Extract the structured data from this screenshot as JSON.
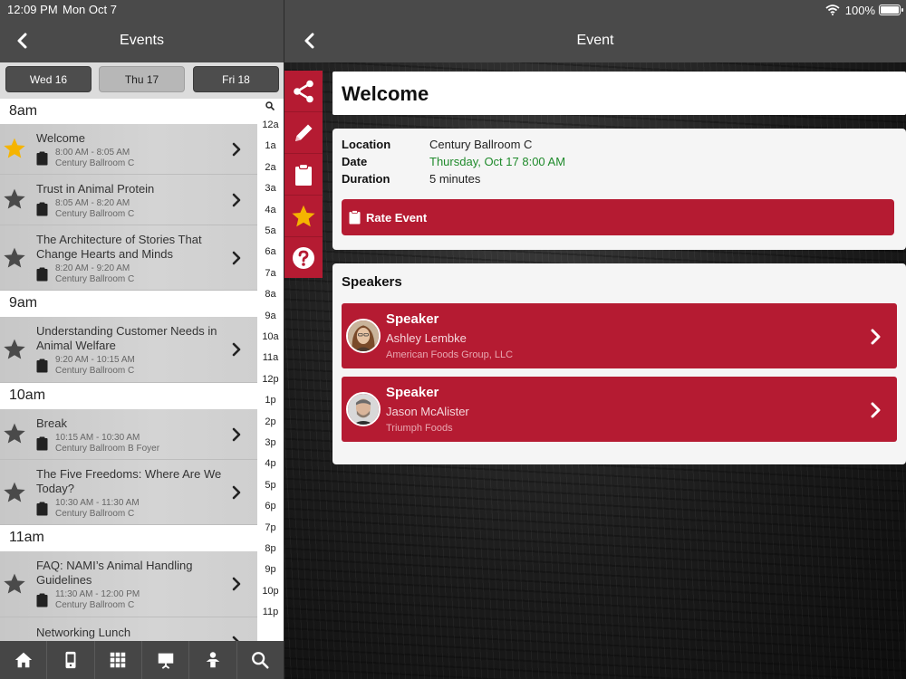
{
  "status": {
    "time": "12:09 PM",
    "date": "Mon Oct 7",
    "battery": "100%"
  },
  "left_nav": {
    "title": "Events"
  },
  "right_nav": {
    "title": "Event"
  },
  "day_tabs": [
    {
      "label": "Wed 16",
      "active": false
    },
    {
      "label": "Thu 17",
      "active": true
    },
    {
      "label": "Fri 18",
      "active": false
    }
  ],
  "hours": [
    "8am",
    "9am",
    "10am",
    "11am"
  ],
  "events": [
    {
      "title": "Welcome",
      "time": "8:00 AM - 8:05 AM",
      "location": "Century Ballroom C",
      "favorited": true
    },
    {
      "title": "Trust in Animal Protein",
      "time": "8:05 AM - 8:20 AM",
      "location": "Century Ballroom C",
      "favorited": false
    },
    {
      "title": "The Architecture of Stories That Change Hearts and Minds",
      "time": "8:20 AM - 9:20 AM",
      "location": "Century Ballroom C",
      "favorited": false
    },
    {
      "title": "Understanding Customer Needs in Animal Welfare",
      "time": "9:20 AM - 10:15 AM",
      "location": "Century Ballroom C",
      "favorited": false
    },
    {
      "title": "Break",
      "time": "10:15 AM - 10:30 AM",
      "location": "Century Ballroom B Foyer",
      "favorited": false
    },
    {
      "title": "The Five Freedoms: Where Are We Today?",
      "time": "10:30 AM - 11:30 AM",
      "location": "Century Ballroom C",
      "favorited": false
    },
    {
      "title": "FAQ: NAMI’s Animal Handling Guidelines",
      "time": "11:30 AM - 12:00 PM",
      "location": "Century Ballroom C",
      "favorited": false
    },
    {
      "title": "Networking Lunch",
      "time": "",
      "location": "",
      "favorited": false
    }
  ],
  "time_index": [
    "12a",
    "1a",
    "2a",
    "3a",
    "4a",
    "5a",
    "6a",
    "7a",
    "8a",
    "9a",
    "10a",
    "11a",
    "12p",
    "1p",
    "2p",
    "3p",
    "4p",
    "5p",
    "6p",
    "7p",
    "8p",
    "9p",
    "10p",
    "11p"
  ],
  "tab_bar": [
    "home-icon",
    "phone-icon",
    "grid-icon",
    "presentation-icon",
    "person-icon",
    "search-icon"
  ],
  "sidebar_actions": [
    "share-icon",
    "edit-icon",
    "clipboard-icon",
    "star-icon",
    "help-icon"
  ],
  "detail": {
    "title": "Welcome",
    "location_label": "Location",
    "location": "Century Ballroom C",
    "date_label": "Date",
    "date": "Thursday, Oct 17 8:00 AM",
    "duration_label": "Duration",
    "duration": "5 minutes",
    "rate_label": "Rate Event",
    "speakers_heading": "Speakers",
    "speakers": [
      {
        "role": "Speaker",
        "name": "Ashley Lembke",
        "company": "American Foods Group, LLC"
      },
      {
        "role": "Speaker",
        "name": "Jason McAlister",
        "company": "Triumph Foods"
      }
    ]
  },
  "colors": {
    "accent": "#b51b32",
    "navbar": "#4a4a4a",
    "date_green": "#1f8a2b",
    "star_gold": "#f5b400",
    "star_gray": "#4a4a4a"
  }
}
